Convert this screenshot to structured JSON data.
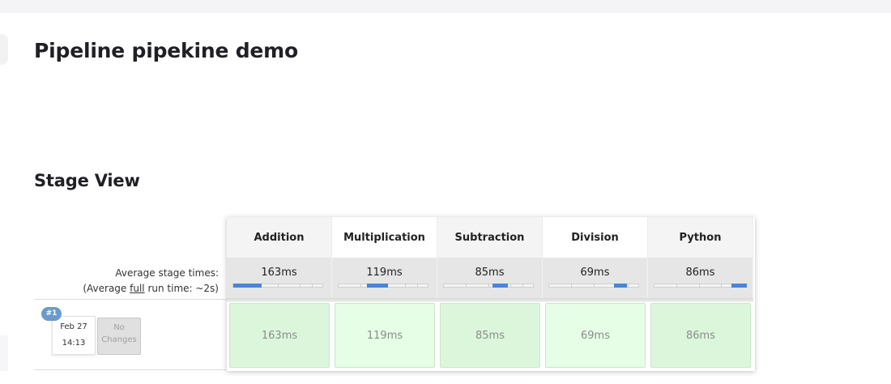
{
  "page": {
    "title": "Pipeline pipekine demo",
    "section_title": "Stage View"
  },
  "summary": {
    "avg_stage_label": "Average stage times:",
    "avg_full_prefix": "(Average ",
    "avg_full_link": "full",
    "avg_full_suffix": " run time: ~2s)"
  },
  "run": {
    "number": "#1",
    "date": "Feb 27",
    "time": "14:13",
    "changes_line1": "No",
    "changes_line2": "Changes"
  },
  "stages": [
    {
      "name": "Addition",
      "avg": "163ms",
      "run": "163ms",
      "avg_fraction": 0.31
    },
    {
      "name": "Multiplication",
      "avg": "119ms",
      "run": "119ms",
      "avg_fraction": 0.23
    },
    {
      "name": "Subtraction",
      "avg": "85ms",
      "run": "85ms",
      "avg_fraction": 0.17
    },
    {
      "name": "Division",
      "avg": "69ms",
      "run": "69ms",
      "avg_fraction": 0.14
    },
    {
      "name": "Python",
      "avg": "86ms",
      "run": "86ms",
      "avg_fraction": 0.17
    }
  ],
  "colors": {
    "success_cell": "#dcf6dc",
    "success_cell_alt": "#e6fde6",
    "progress_fill": "#4a84d8",
    "run_badge": "#6b9acb"
  }
}
